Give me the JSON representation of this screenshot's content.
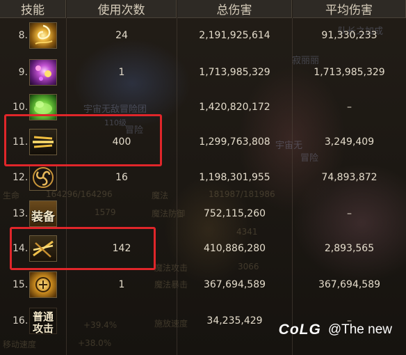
{
  "headers": {
    "skill": "技能",
    "uses": "使用次数",
    "total": "总伤害",
    "avg": "平均伤害"
  },
  "rows": [
    {
      "index": "8.",
      "icon": "golden-vortex-icon",
      "uses": "24",
      "total": "2,191,925,614",
      "avg": "91,330,233"
    },
    {
      "index": "9.",
      "icon": "purple-burst-icon",
      "uses": "1",
      "total": "1,713,985,329",
      "avg": "1,713,985,329"
    },
    {
      "index": "10.",
      "icon": "green-cloud-icon",
      "uses": "",
      "total": "1,420,820,172",
      "avg": "–"
    },
    {
      "index": "11.",
      "icon": "triple-bolt-icon",
      "uses": "400",
      "total": "1,299,763,808",
      "avg": "3,249,409"
    },
    {
      "index": "12.",
      "icon": "triskelion-icon",
      "uses": "16",
      "total": "1,198,301,955",
      "avg": "74,893,872"
    },
    {
      "index": "13.",
      "icon": "equipment-icon",
      "icon_text": "装备",
      "uses": "",
      "total": "752,115,260",
      "avg": "–"
    },
    {
      "index": "14.",
      "icon": "crossed-bolts-icon",
      "uses": "142",
      "total": "410,886,280",
      "avg": "2,893,565"
    },
    {
      "index": "15.",
      "icon": "golden-emblem-icon",
      "uses": "1",
      "total": "367,694,589",
      "avg": "367,694,589"
    },
    {
      "index": "16.",
      "icon": "normal-attack-icon",
      "icon_text_top": "普通",
      "icon_text_bottom": "攻击",
      "uses": "",
      "total": "34,235,429",
      "avg": "–"
    }
  ],
  "background_ghost_text": {
    "g1": "宇宙无敌冒险团",
    "g2": "冒险",
    "g3": "110级",
    "g4": "宇宙无",
    "g5": "队长之加成",
    "g6": "寂丽丽",
    "g7": "冒险",
    "g8": "魔法",
    "g9": "181987/181986",
    "g10": "魔法防御",
    "g11": "4341",
    "g12": "魔法攻击",
    "g13": "3066",
    "g14": "魔法暴击",
    "g15": "施放速度",
    "g16": "移动速度",
    "g17": "+39.4%",
    "g18": "+38.0%",
    "g19": "生命",
    "g20": "164296/164296",
    "g21": "1579"
  },
  "watermark": {
    "logo": "CoLG",
    "text": "@The new"
  },
  "colors": {
    "highlight": "#e0262a",
    "header_bg": "#2e2a25",
    "text": "#e4dccb"
  }
}
